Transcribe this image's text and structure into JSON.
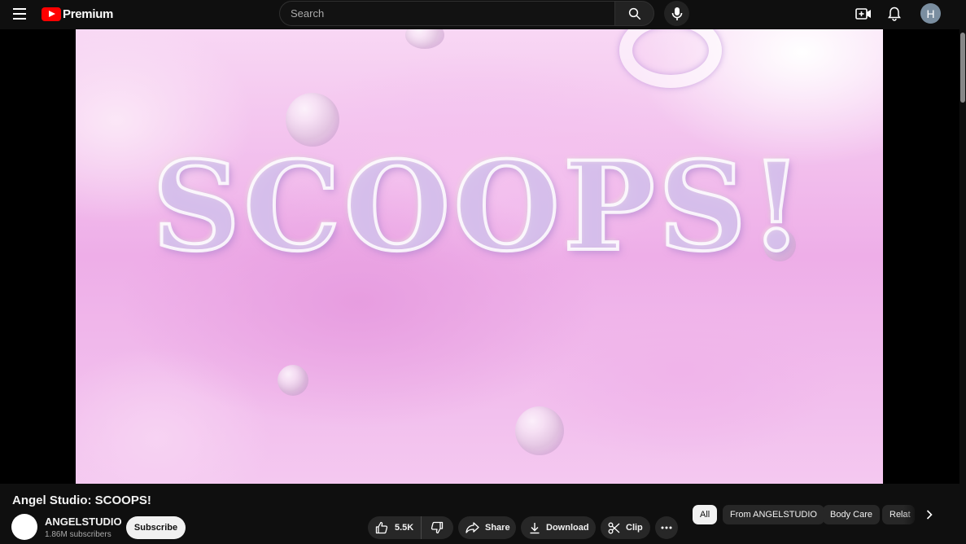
{
  "header": {
    "logo_text": "Premium",
    "search_placeholder": "Search",
    "avatar_letter": "H"
  },
  "video": {
    "overlay_text": "SCOOPS!",
    "title": "Angel Studio: SCOOPS!"
  },
  "channel": {
    "name": "ANGELSTUDIO",
    "subscribers": "1.86M subscribers",
    "subscribe_label": "Subscribe"
  },
  "actions": {
    "likes": "5.5K",
    "share_label": "Share",
    "download_label": "Download",
    "clip_label": "Clip"
  },
  "chips": [
    {
      "label": "All",
      "active": true
    },
    {
      "label": "From ANGELSTUDIO",
      "active": false
    },
    {
      "label": "Body Care",
      "active": false
    },
    {
      "label": "Relat",
      "active": false
    }
  ],
  "colors": {
    "background": "#0f0f0f",
    "brand_red": "#ff0000",
    "pill_bg": "#272727",
    "avatar_bg": "#7a8ea0"
  }
}
